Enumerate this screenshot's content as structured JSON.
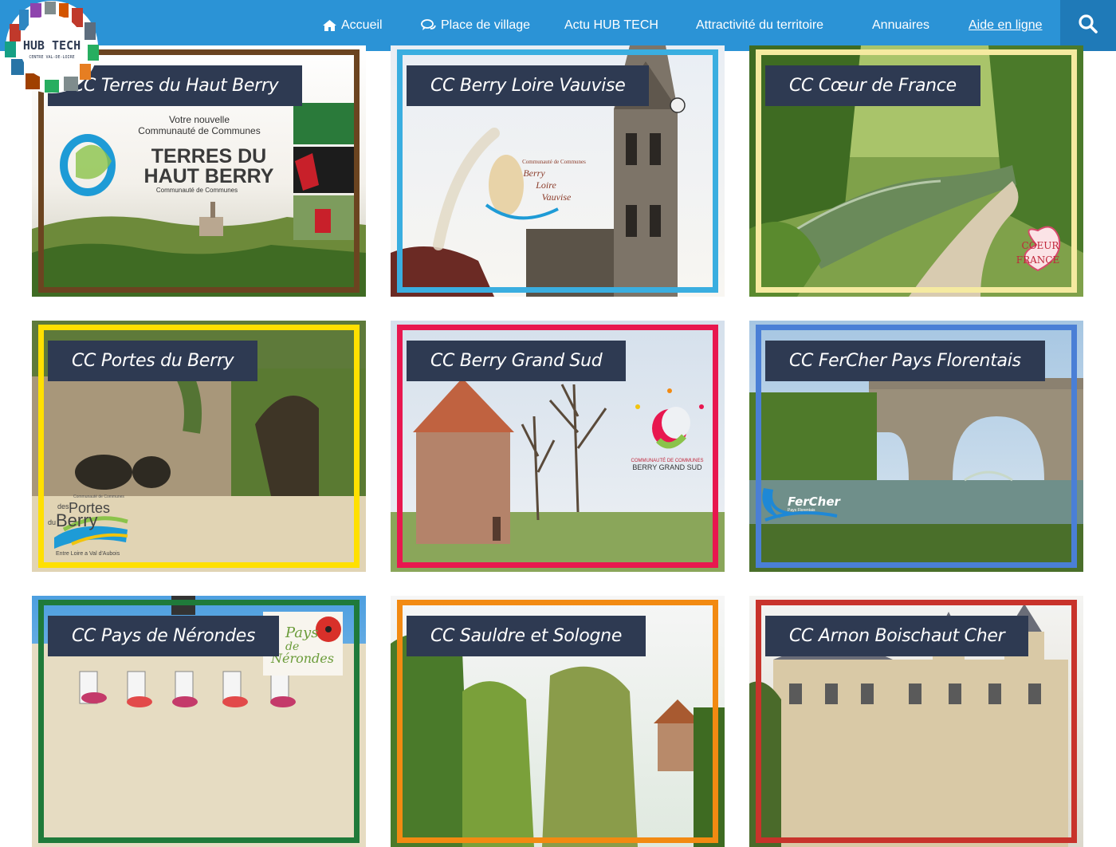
{
  "nav": {
    "home": "Accueil",
    "village": "Place de village",
    "actu": "Actu HUB TECH",
    "attract": "Attractivité du territoire",
    "annuaires": "Annuaires",
    "aide": "Aide en ligne"
  },
  "logo": {
    "line1": "HUB TECH",
    "line2": "CENTRE VAL-DE-LOIRE"
  },
  "colors": {
    "topbar": "#2b93d6",
    "search_bg": "#1f7ab8",
    "title_bg": "#2e3a52"
  },
  "cards": [
    {
      "title": "CC Terres du Haut Berry",
      "frame": "#6b4420"
    },
    {
      "title": "CC Berry Loire Vauvise",
      "frame": "#3aaee0"
    },
    {
      "title": "CC Cœur de France",
      "frame": "#f5eaa0"
    },
    {
      "title": "CC Portes du Berry",
      "frame": "#ffe000"
    },
    {
      "title": "CC Berry Grand Sud",
      "frame": "#e8174f"
    },
    {
      "title": "CC FerCher Pays Florentais",
      "frame": "#4a7fd6"
    },
    {
      "title": "CC Pays de Nérondes",
      "frame": "#1f7a3a"
    },
    {
      "title": "CC Sauldre et Sologne",
      "frame": "#f28a12"
    },
    {
      "title": "CC Arnon Boischaut Cher",
      "frame": "#c8332b"
    }
  ],
  "card_text": {
    "thb_line1": "Votre nouvelle",
    "thb_line2": "Communauté de Communes",
    "thb_big1": "TERRES DU",
    "thb_big2": "HAUT BERRY",
    "thb_small": "Communauté de Communes",
    "blv_logo1": "Communauté de Communes",
    "blv_logo2": "Berry",
    "blv_logo3": "Loire",
    "blv_logo4": "Vauvise",
    "cdf_logo1": "COEUR",
    "cdf_logo2": "FRANCE",
    "pdb_small": "Communauté de Communes",
    "pdb_des": "des",
    "pdb_portes": "Portes",
    "pdb_du": "du",
    "pdb_berry": "Berry",
    "pdb_tag": "Entre Loire a Val d'Aubois",
    "bgs_logo1": "COMMUNAUTÉ DE COMMUNES",
    "bgs_logo2": "BERRY GRAND SUD",
    "fc_logo": "FerCher",
    "fc_small": "Pays Florentais",
    "pn_logo1": "Pays",
    "pn_logo2": "de",
    "pn_logo3": "Nérondes"
  }
}
